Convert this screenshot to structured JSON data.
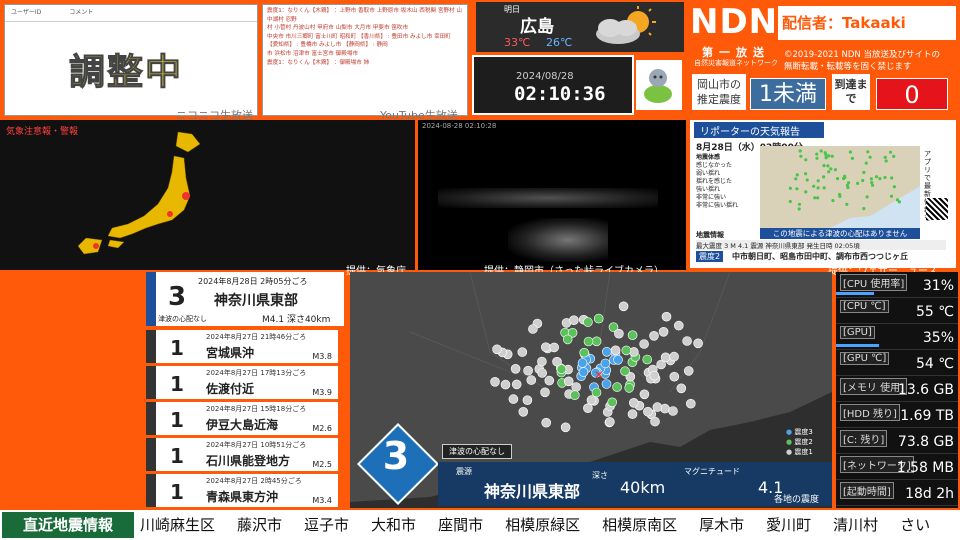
{
  "niconico": {
    "header": [
      "ユーザーID",
      "コメント"
    ],
    "status": "調整中",
    "caption": "ニコニコ生放送"
  },
  "youtube": {
    "lines": [
      "震度1：なりくん【木鶏】 ：上野市 香取市 上野原市 坂木山 西税関 宮野村 山中湖村 忍野",
      "村 小菅村 丹波山村 甲府市 山梨市 大月市 甲斐市 笛吹市",
      "中央市 市川三郷町 富士川町 昭和町 【香川県】 : 豊田市 みよし市 幸田町",
      "【愛知県】 : 豊橋市 みよし市 【静岡県】 : 静岡",
      "市 浜松市 沼津市 富士宮市 御殿場市",
      "震度1：なりくん【木鶏】 ：御殿場市 姉"
    ],
    "caption": "YouTube生放送"
  },
  "weather": {
    "label": "明日",
    "city": "広島",
    "high": "33℃",
    "low": "26℃",
    "icon": "cloudy-sunny-icon"
  },
  "clock": {
    "date": "2024/08/28",
    "time": "02:10:36"
  },
  "ndn": {
    "logo": "NDN",
    "streamer": "配信者：Takaaki",
    "channel": "第一放送",
    "sub": "自然災害報道ネットワーク",
    "copyright": "©2019-2021 NDN 当放送及びサイトの",
    "notice": "無断転載・転載等を固く禁じます",
    "city_label": "岡山市の推定震度",
    "intensity": "1未満",
    "arrival_label": "到達まで",
    "arrival": "0"
  },
  "jma_map": {
    "title": "気象注意報・警報",
    "credit": "提供：気象庁"
  },
  "camera": {
    "timestamp": "2024-08-28 02:10:28",
    "credit": "提供：静岡市（さった峠ライブカメラ）"
  },
  "weathernews": {
    "header": "リポーターの天気報告",
    "datetime": "8月28日（水）02時00分",
    "legend_title": "地震体感",
    "legend": [
      "感じなかった",
      "弱い揺れ",
      "揺れを感じた",
      "強い揺れ",
      "非常に強い",
      "非常に強い揺れ"
    ],
    "tsunami": "この地震による津波の心配はありません",
    "info_title": "地震情報",
    "info_row": "最大震度 3  M 4.1  震源 神奈川県東部  発生日時 02:05頃",
    "cities_label": "震度2",
    "cities": "中市朝日町、昭島市田中町、調布市西つつじヶ丘",
    "side_note": "アプリで最新情報を",
    "credit": "提供：ウェザーニュース"
  },
  "quakes": {
    "latest": {
      "intensity": "3",
      "datetime": "2024年8月28日 2時05分ごろ",
      "place": "神奈川県東部",
      "tsunami": "津波の心配なし",
      "magdepth": "M4.1 深さ40km"
    },
    "history": [
      {
        "intensity": "1",
        "datetime": "2024年8月27日 21時46分ごろ",
        "place": "宮城県沖",
        "mag": "M3.8"
      },
      {
        "intensity": "1",
        "datetime": "2024年8月27日 17時13分ごろ",
        "place": "佐渡付近",
        "mag": "M3.9"
      },
      {
        "intensity": "1",
        "datetime": "2024年8月27日 15時18分ごろ",
        "place": "伊豆大島近海",
        "mag": "M2.6"
      },
      {
        "intensity": "1",
        "datetime": "2024年8月27日 10時51分ごろ",
        "place": "石川県能登地方",
        "mag": "M2.5"
      },
      {
        "intensity": "1",
        "datetime": "2024年8月27日 2時45分ごろ",
        "place": "青森県東方沖",
        "mag": "M3.4"
      }
    ]
  },
  "quake_map": {
    "intensity": "3",
    "tsunami": "津波の心配なし",
    "epicenter_label": "震源",
    "epicenter": "神奈川県東部",
    "depth_label": "深さ",
    "depth": "40km",
    "mag_label": "マグニチュード",
    "mag": "4.1",
    "legend": [
      "震度3",
      "震度2",
      "震度1"
    ],
    "footer": "各地の震度",
    "colors": {
      "s3": "#4aa3e8",
      "s2": "#5bc25b",
      "s1": "#cfcfcf"
    }
  },
  "stats": [
    {
      "label": "[CPU 使用率]",
      "value": "31%",
      "fill": 0.31
    },
    {
      "label": "[CPU ℃]",
      "value": "55 ℃",
      "fill": 0
    },
    {
      "label": "[GPU]",
      "value": "35%",
      "fill": 0.35
    },
    {
      "label": "[GPU ℃]",
      "value": "54 ℃",
      "fill": 0
    },
    {
      "label": "[メモリ 使用]",
      "value": "13.6 GB",
      "fill": 0
    },
    {
      "label": "[HDD 残り]",
      "value": "1.69 TB",
      "fill": 0
    },
    {
      "label": "[C: 残り]",
      "value": "73.8 GB",
      "fill": 0
    },
    {
      "label": "[ネットワーク]",
      "value": "1.58 MB",
      "fill": 0
    },
    {
      "label": "[起動時間]",
      "value": "18d 2h",
      "fill": 0
    }
  ],
  "ticker": {
    "label": "直近地震情報",
    "cities": [
      "川崎麻生区",
      "藤沢市",
      "逗子市",
      "大和市",
      "座間市",
      "相模原緑区",
      "相模原南区",
      "厚木市",
      "愛川町",
      "清川村",
      "さい"
    ]
  }
}
